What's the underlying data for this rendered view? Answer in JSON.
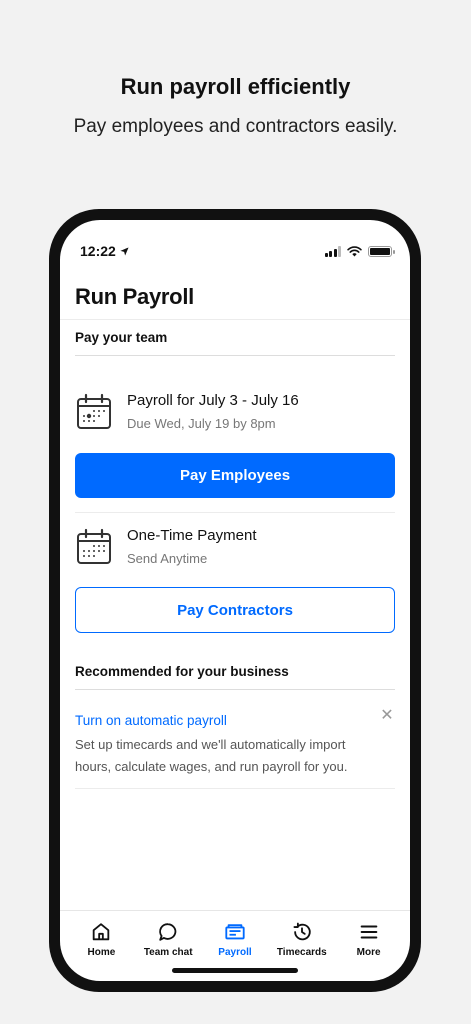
{
  "promo": {
    "title": "Run payroll efficiently",
    "subtitle": "Pay employees and contractors easily."
  },
  "status_bar": {
    "time": "12:22",
    "location_icon": "location-arrow-icon",
    "signal_icon": "cellular-signal-icon",
    "wifi_icon": "wifi-icon",
    "battery_icon": "battery-icon"
  },
  "header": {
    "title": "Run Payroll"
  },
  "pay_team": {
    "heading": "Pay your team",
    "payroll": {
      "icon": "calendar-icon",
      "title": "Payroll for July 3 - July 16",
      "due": "Due Wed, July 19 by 8pm",
      "button": "Pay Employees"
    },
    "one_time": {
      "icon": "calendar-icon",
      "title": "One-Time Payment",
      "subtitle": "Send Anytime",
      "button": "Pay Contractors"
    }
  },
  "recommended": {
    "heading": "Recommended for your business",
    "link": "Turn on automatic payroll",
    "body": "Set up timecards and we'll automatically import hours, calculate wages, and run payroll for you.",
    "close_icon": "close-icon"
  },
  "tabs": [
    {
      "label": "Home",
      "icon": "home-icon",
      "active": false
    },
    {
      "label": "Team chat",
      "icon": "chat-bubble-icon",
      "active": false
    },
    {
      "label": "Payroll",
      "icon": "payroll-icon",
      "active": true
    },
    {
      "label": "Timecards",
      "icon": "history-clock-icon",
      "active": false
    },
    {
      "label": "More",
      "icon": "menu-icon",
      "active": false
    }
  ],
  "colors": {
    "accent": "#006aff",
    "background": "#f2f2f2",
    "text": "#111111",
    "muted": "#777777"
  }
}
